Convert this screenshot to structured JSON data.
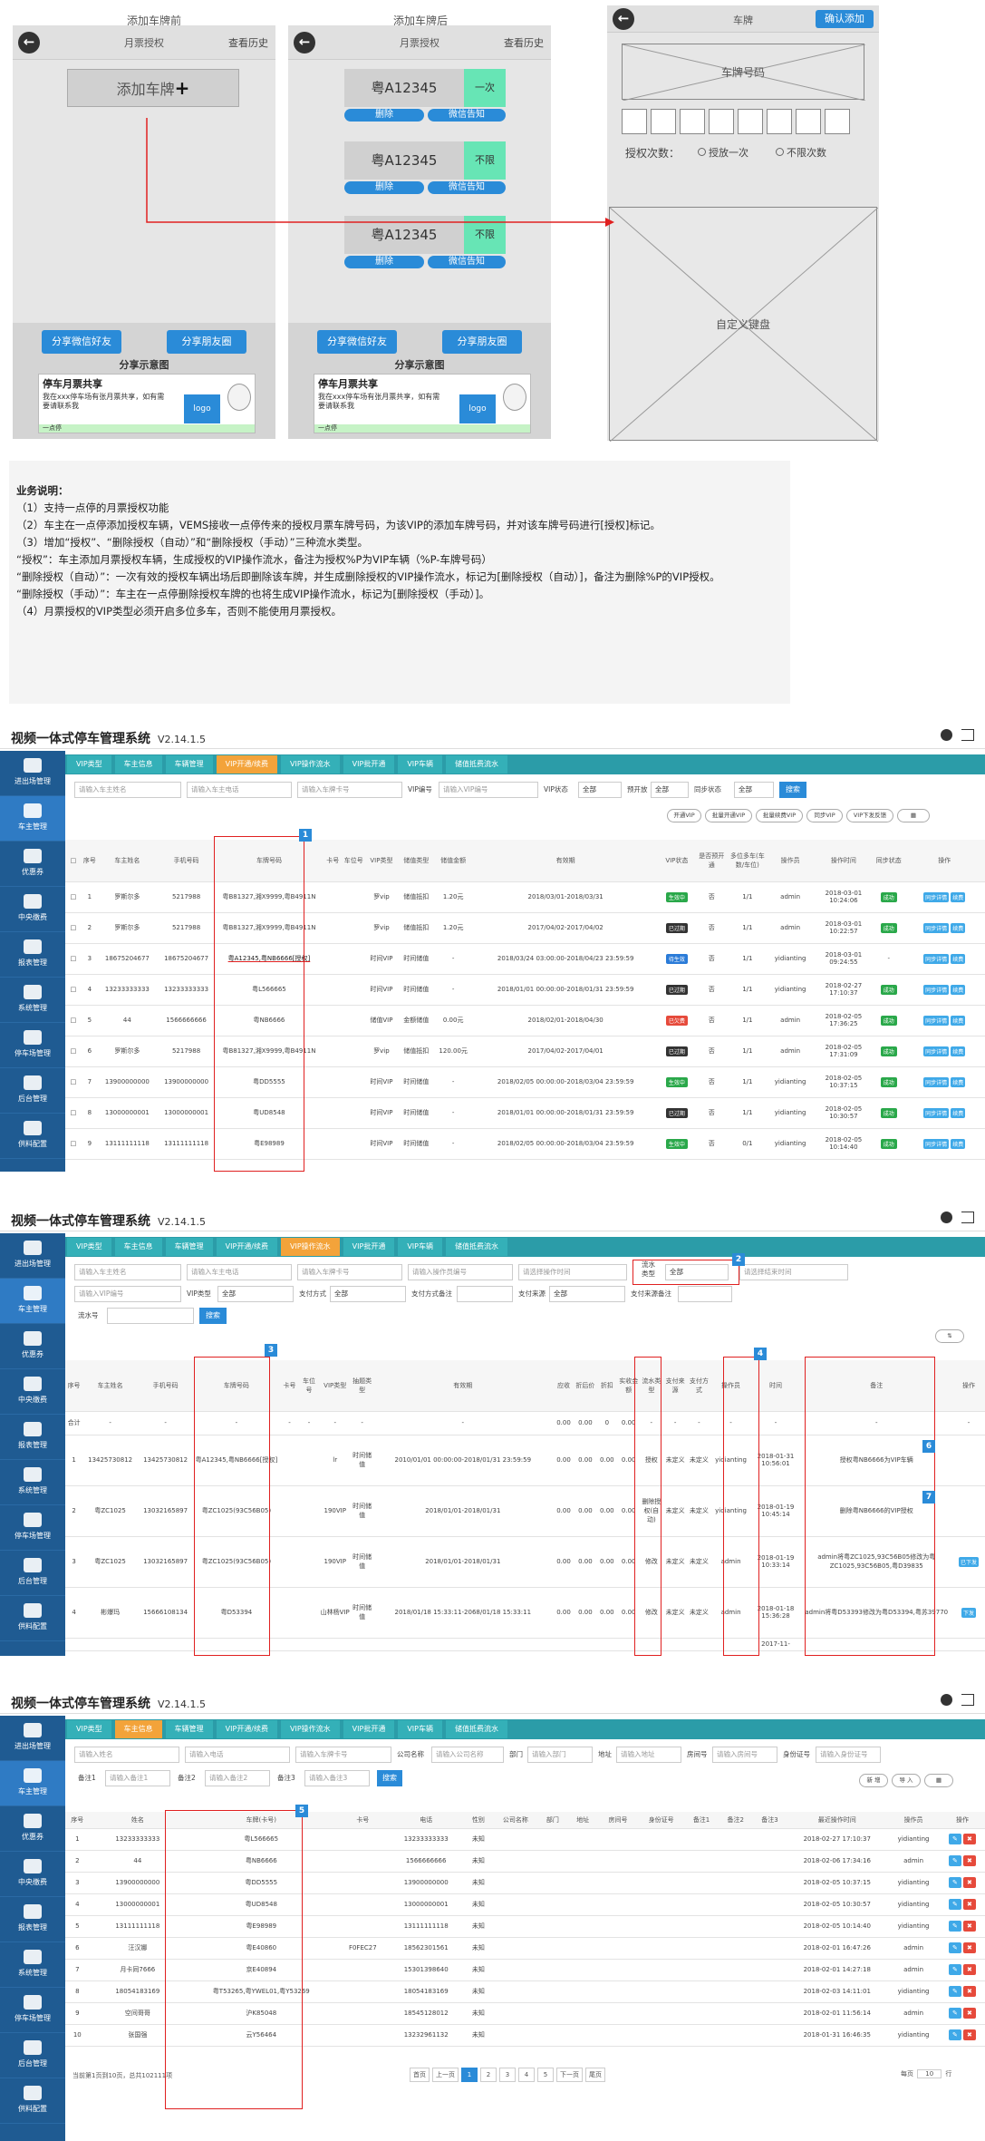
{
  "mock": {
    "before_label": "添加车牌前",
    "after_label": "添加车牌后",
    "title": "月票授权",
    "history": "查看历史",
    "add_plate": "添加车牌",
    "plus": "+",
    "plates": [
      {
        "plate": "粤A12345",
        "mode": "一次",
        "del": "删除",
        "wechat": "微信告知"
      },
      {
        "plate": "粤A12345",
        "mode": "不限",
        "del": "删除",
        "wechat": "微信告知"
      },
      {
        "plate": "粤A12345",
        "mode": "不限",
        "del": "删除",
        "wechat": "微信告知"
      }
    ],
    "share_wechat": "分享微信好友",
    "share_moments": "分享朋友圈",
    "share_caption": "分享示意图",
    "card_title": "停车月票共享",
    "card_text": "我在xxx停车场有张月票共享，如有需要请联系我",
    "card_logo": "logo",
    "card_brand": "一点停",
    "plate_screen_title": "车牌",
    "confirm_add": "确认添加",
    "plate_box": "车牌号码",
    "auth_count": "授权次数：",
    "opt_once": "授放一次",
    "opt_unlimited": "不限次数",
    "keyboard": "自定义键盘"
  },
  "spec": {
    "heading": "业务说明：",
    "lines": [
      "（1）支持一点停的月票授权功能",
      "（2）车主在一点停添加授权车辆，VEMS接收一点停传来的授权月票车牌号码，为该VIP的添加车牌号码，并对该车牌号码进行[授权]标记。",
      "（3）增加“授权”、“删除授权（自动）”和“删除授权（手动）”三种流水类型。",
      "“授权”：车主添加月票授权车辆，生成授权的VIP操作流水，备注为授权%P为VIP车辆（%P-车牌号码）",
      "“删除授权（自动）”：一次有效的授权车辆出场后即删除该车牌，并生成删除授权的VIP操作流水，标记为[删除授权（自动）]，备注为删除%P的VIP授权。",
      "“删除授权（手动）”：车主在一点停删除授权车牌的也将生成VIP操作流水，标记为[删除授权（手动）]。",
      "（4）月票授权的VIP类型必须开启多位多车，否则不能使用月票授权。"
    ]
  },
  "app": {
    "title": "视频一体式停车管理系统",
    "version": "V2.14.1.5",
    "sidebar": [
      "进出场管理",
      "车主管理",
      "优惠券",
      "中央缴费",
      "报表管理",
      "系统管理",
      "停车场管理",
      "后台管理",
      "供料配置"
    ],
    "tabs1": [
      "VIP类型",
      "车主信息",
      "车辆管理",
      "VIP开通/续费",
      "VIP操作流水",
      "VIP批开通",
      "VIP车辆",
      "储值抵费流水"
    ],
    "tabs2": [
      "VIP类型",
      "车主信息",
      "车辆管理",
      "VIP开通/续费",
      "VIP操作流水",
      "VIP批开通",
      "VIP车辆",
      "储值抵费流水"
    ],
    "tabs3": [
      "VIP类型",
      "车主信息",
      "车辆管理",
      "VIP开通/续费",
      "VIP操作流水",
      "VIP批开通",
      "VIP车辆",
      "储值抵费流水"
    ]
  },
  "s1": {
    "filters": {
      "owner": "请输入车主姓名",
      "phone": "请输入车主电话",
      "plate": "请输入车牌卡号",
      "vipno_lbl": "VIP编号",
      "vipno": "请输入VIP编号",
      "vipstatus_lbl": "VIP状态",
      "all": "全部",
      "share_lbl": "预开放",
      "sync_lbl": "同步状态",
      "search": "搜索"
    },
    "actions": [
      "开通VIP",
      "批量开通VIP",
      "批量续费VIP",
      "同步VIP",
      "VIP下发反馈"
    ],
    "headers": [
      "序号",
      "车主姓名",
      "手机号码",
      "车牌号码",
      "卡号",
      "车位号",
      "VIP类型",
      "储值类型",
      "储值金额",
      "有效期",
      "VIP状态",
      "是否预开通",
      "多位多车(车数/车位)",
      "操作员",
      "操作时间",
      "同步状态",
      "操作"
    ],
    "rows": [
      [
        "1",
        "罗斯尔多",
        "5217988",
        "粤B81327,湘X9999,粤B4911N",
        "",
        "",
        "罗vip",
        "储值抵扣",
        "1.20元",
        "2018/03/01-2018/03/31",
        "生效中",
        "否",
        "1/1",
        "admin",
        "2018-03-01 10:24:06",
        "成功"
      ],
      [
        "2",
        "罗斯尔多",
        "5217988",
        "粤B81327,湘X9999,粤B4911N",
        "",
        "",
        "罗vip",
        "储值抵扣",
        "1.20元",
        "2017/04/02-2017/04/02",
        "已过期",
        "否",
        "1/1",
        "admin",
        "2018-03-01 10:22:57",
        "成功"
      ],
      [
        "3",
        "18675204677",
        "18675204677",
        "粤A12345,粤NB6666[授权]",
        "",
        "",
        "时间VIP",
        "时间储值",
        "-",
        "2018/03/24 03:00:00-2018/04/23 23:59:59",
        "待生效",
        "否",
        "1/1",
        "yidianting",
        "2018-03-01 09:24:55",
        "-"
      ],
      [
        "4",
        "13233333333",
        "13233333333",
        "粤L566665",
        "",
        "",
        "时间VIP",
        "时间储值",
        "-",
        "2018/01/01 00:00:00-2018/01/31 23:59:59",
        "已过期",
        "否",
        "1/1",
        "yidianting",
        "2018-02-27 17:10:37",
        "成功"
      ],
      [
        "5",
        "44",
        "1566666666",
        "粤NB6666",
        "",
        "",
        "储值VIP",
        "金额储值",
        "0.00元",
        "2018/02/01-2018/04/30",
        "已欠费",
        "否",
        "1/1",
        "admin",
        "2018-02-05 17:36:25",
        "成功"
      ],
      [
        "6",
        "罗斯尔多",
        "5217988",
        "粤B81327,湘X9999,粤B4911N",
        "",
        "",
        "罗vip",
        "储值抵扣",
        "120.00元",
        "2017/04/02-2017/04/01",
        "已过期",
        "否",
        "1/1",
        "admin",
        "2018-02-05 17:31:09",
        "成功"
      ],
      [
        "7",
        "13900000000",
        "13900000000",
        "粤DD5555",
        "",
        "",
        "时间VIP",
        "时间储值",
        "-",
        "2018/02/05 00:00:00-2018/03/04 23:59:59",
        "生效中",
        "否",
        "1/1",
        "yidianting",
        "2018-02-05 10:37:15",
        "成功"
      ],
      [
        "8",
        "13000000001",
        "13000000001",
        "粤UD8548",
        "",
        "",
        "时间VIP",
        "时间储值",
        "-",
        "2018/01/01 00:00:00-2018/01/31 23:59:59",
        "已过期",
        "否",
        "1/1",
        "yidianting",
        "2018-02-05 10:30:57",
        "成功"
      ],
      [
        "9",
        "13111111118",
        "13111111118",
        "粤E98989",
        "",
        "",
        "时间VIP",
        "时间储值",
        "-",
        "2018/02/05 00:00:00-2018/03/04 23:59:59",
        "生效中",
        "否",
        "0/1",
        "yidianting",
        "2018-02-05 10:14:40",
        "成功"
      ]
    ],
    "op_buttons": [
      "同步详情",
      "续费"
    ],
    "badge": "1"
  },
  "s2": {
    "filters": {
      "owner": "请输入车主姓名",
      "phone": "请输入车主电话",
      "plate": "请输入车牌卡号",
      "operator": "请输入操作员编号",
      "time_from": "请选择操作时间",
      "flow_type_lbl": "流水类型",
      "flow_type_val": "全部",
      "time_to": "请选择结束时间",
      "vipno": "请输入VIP编号",
      "viptype_lbl": "VIP类型",
      "all": "全部",
      "pay_lbl": "支付方式",
      "paynote_lbl": "支付方式备注",
      "paysrc_lbl": "支付来源",
      "paysrcnote_lbl": "支付来源备注",
      "flowno_lbl": "流水号",
      "search": "搜索"
    },
    "headers": [
      "序号",
      "车主姓名",
      "手机号码",
      "车牌号码",
      "卡号",
      "车位号",
      "VIP类型",
      "抽题类型",
      "有效期",
      "应收",
      "折后价",
      "折扣",
      "实收金额",
      "流水类型",
      "支付来源",
      "支付方式",
      "操作员",
      "时间",
      "备注",
      "操作"
    ],
    "total_row": [
      "合计",
      "-",
      "-",
      "-",
      "-",
      "-",
      "-",
      "-",
      "-",
      "0.00",
      "0.00",
      "0",
      "0.00",
      "-",
      "-",
      "-",
      "-",
      "-",
      "-",
      "-"
    ],
    "rows": [
      [
        "1",
        "13425730812",
        "13425730812",
        "粤A12345,粤NB6666[授权]",
        "",
        "",
        "lr",
        "时间储值",
        "2010/01/01 00:00:00-2018/01/31 23:59:59",
        "0.00",
        "0.00",
        "0.00",
        "0.00",
        "授权",
        "未定义",
        "未定义",
        "yidianting",
        "2018-01-31 10:56:01",
        "授权粤NB6666为VIP车辆",
        ""
      ],
      [
        "2",
        "粤ZC1025",
        "13032165897",
        "粤ZC1025(93C56B05)",
        "",
        "",
        "190VIP",
        "时间储值",
        "2018/01/01-2018/01/31",
        "0.00",
        "0.00",
        "0.00",
        "0.00",
        "删除授权(自动)",
        "未定义",
        "未定义",
        "yidianting",
        "2018-01-19 10:45:14",
        "删除粤NB6666的VIP授权",
        ""
      ],
      [
        "3",
        "粤ZC1025",
        "13032165897",
        "粤ZC1025(93C56B05)",
        "",
        "",
        "190VIP",
        "时间储值",
        "2018/01/01-2018/01/31",
        "0.00",
        "0.00",
        "0.00",
        "0.00",
        "修改",
        "未定义",
        "未定义",
        "admin",
        "2018-01-19 10:33:14",
        "admin将粤ZC1025,93C56B05修改为粤ZC1025,93C56B05,粤D39835",
        "已下发"
      ],
      [
        "4",
        "彬爆玛",
        "15666108134",
        "粤D53394",
        "",
        "",
        "山林杨VIP",
        "时间储值",
        "2018/01/18 15:33:11-2068/01/18 15:33:11",
        "0.00",
        "0.00",
        "0.00",
        "0.00",
        "修改",
        "未定义",
        "未定义",
        "admin",
        "2018-01-18 15:36:28",
        "admin将粤D53393修改为粤D53394,粤苏39770",
        "下发"
      ]
    ],
    "row5_time": "2017-11-",
    "badges": [
      "2",
      "3",
      "4",
      "6",
      "7"
    ]
  },
  "s3": {
    "filters": {
      "owner": "请输入姓名",
      "phone": "请输入电话",
      "plate": "请输入车牌卡号",
      "company_lbl": "公司名称",
      "company": "请输入公司名称",
      "dept_lbl": "部门",
      "dept": "请输入部门",
      "addr_lbl": "地址",
      "addr": "请输入地址",
      "room_lbl": "房间号",
      "room": "请输入房间号",
      "id_lbl": "身份证号",
      "id": "请输入身份证号",
      "note1_lbl": "备注1",
      "note1": "请输入备注1",
      "note2_lbl": "备注2",
      "note2": "请输入备注2",
      "note3_lbl": "备注3",
      "note3": "请输入备注3",
      "search": "搜索",
      "add": "新 增",
      "import": "导 入"
    },
    "headers": [
      "序号",
      "姓名",
      "车牌(卡号)",
      "卡号",
      "电话",
      "性别",
      "公司名称",
      "部门",
      "地址",
      "房间号",
      "身份证号",
      "备注1",
      "备注2",
      "备注3",
      "最近操作时间",
      "操作员",
      "操作"
    ],
    "rows": [
      [
        "1",
        "13233333333",
        "粤L566665",
        "",
        "13233333333",
        "未知",
        "2018-02-27 17:10:37",
        "yidianting"
      ],
      [
        "2",
        "44",
        "粤NB6666",
        "",
        "1566666666",
        "未知",
        "2018-02-06 17:34:16",
        "admin"
      ],
      [
        "3",
        "13900000000",
        "粤DD5555",
        "",
        "13900000000",
        "未知",
        "2018-02-05 10:37:15",
        "yidianting"
      ],
      [
        "4",
        "13000000001",
        "粤UD8548",
        "",
        "13000000001",
        "未知",
        "2018-02-05 10:30:57",
        "yidianting"
      ],
      [
        "5",
        "13111111118",
        "粤E98989",
        "",
        "13111111118",
        "未知",
        "2018-02-05 10:14:40",
        "yidianting"
      ],
      [
        "6",
        "汪汉娜",
        "粤E40860",
        "F0FEC27",
        "18562301561",
        "未知",
        "2018-02-01 16:47:26",
        "admin"
      ],
      [
        "7",
        "月卡同7666",
        "京E40894",
        "",
        "15301398640",
        "未知",
        "2018-02-01 14:27:18",
        "admin"
      ],
      [
        "8",
        "18054183169",
        "粤T53265,粤YWEL01,粤Y53269",
        "",
        "18054183169",
        "未知",
        "2018-02-03 14:11:01",
        "yidianting"
      ],
      [
        "9",
        "空间哥哥",
        "沪K85048",
        "",
        "18545128012",
        "未知",
        "2018-02-01 11:56:14",
        "admin"
      ],
      [
        "10",
        "张国强",
        "云Y56464",
        "",
        "13232961132",
        "未知",
        "2018-01-31 16:46:35",
        "yidianting"
      ]
    ],
    "footer": "当前第1页到10页，总共102111项",
    "pager": [
      "首页",
      "上一页",
      "1",
      "2",
      "3",
      "4",
      "5",
      "下一页",
      "尾页"
    ],
    "page_size_lbl": "每页",
    "page_size": "10",
    "page_size_unit": "行",
    "badge": "5"
  }
}
